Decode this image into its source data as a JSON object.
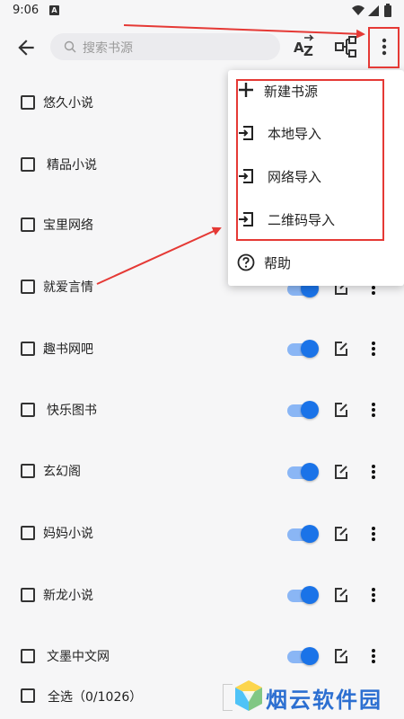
{
  "status_bar": {
    "time": "9:06",
    "notification_letter": "A"
  },
  "toolbar": {
    "search_placeholder": "搜索书源"
  },
  "sources": [
    {
      "name": "悠久小说",
      "enabled": true
    },
    {
      "name": "精品小说",
      "enabled": true
    },
    {
      "name": "宝里网络",
      "enabled": true
    },
    {
      "name": "就爱言情",
      "enabled": true
    },
    {
      "name": "趣书网吧",
      "enabled": true
    },
    {
      "name": "快乐图书",
      "enabled": true
    },
    {
      "name": "玄幻阁",
      "enabled": true
    },
    {
      "name": "妈妈小说",
      "enabled": true
    },
    {
      "name": "新龙小说",
      "enabled": true
    },
    {
      "name": "文墨中文网",
      "enabled": true
    }
  ],
  "menu": {
    "items": [
      {
        "label": "新建书源",
        "icon": "plus-icon"
      },
      {
        "label": "本地导入",
        "icon": "import-icon"
      },
      {
        "label": "网络导入",
        "icon": "import-icon"
      },
      {
        "label": "二维码导入",
        "icon": "import-icon"
      },
      {
        "label": "帮助",
        "icon": "help-icon"
      }
    ]
  },
  "bottom_bar": {
    "select_all_label": "全选（0/1026）"
  },
  "watermark": {
    "text": "烟云软件园"
  },
  "colors": {
    "accent": "#1a73e8",
    "annotation": "#e53935"
  }
}
